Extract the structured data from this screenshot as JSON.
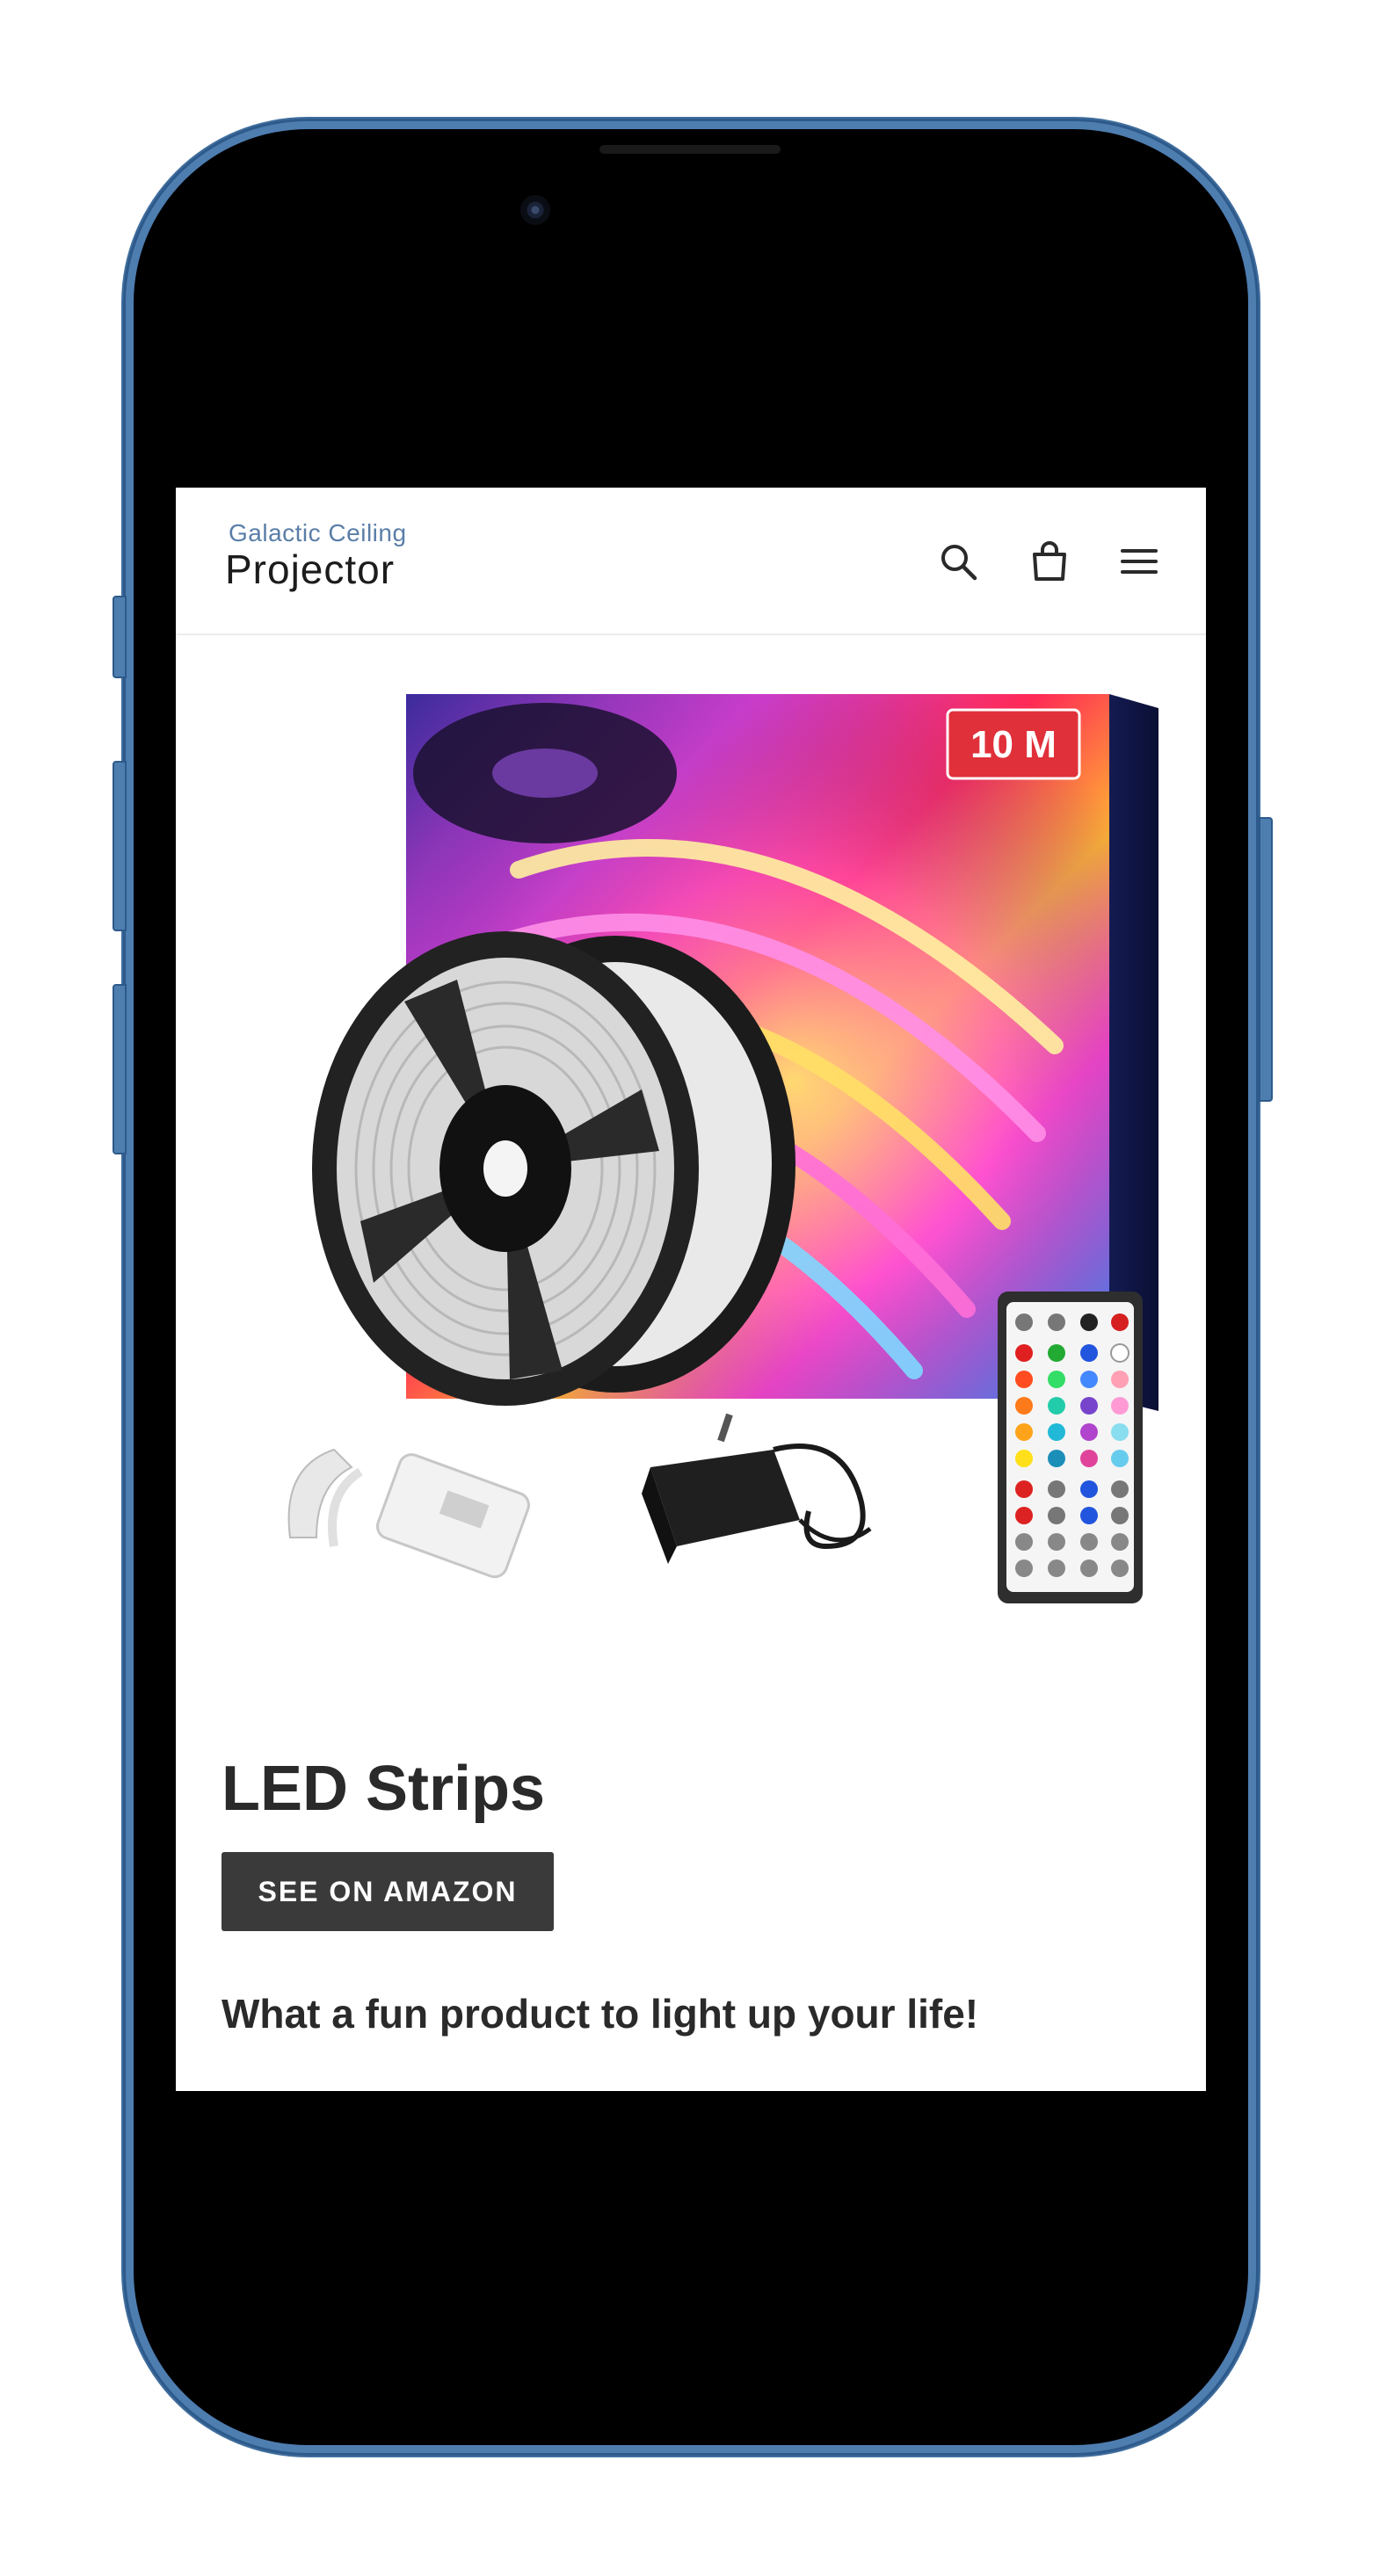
{
  "header": {
    "logo": {
      "top_text": "Galactic Ceiling",
      "bottom_text": "Projector"
    },
    "icons": [
      "search-icon",
      "cart-icon",
      "hamburger-menu-icon"
    ]
  },
  "product": {
    "image_alt": "LED strip light kit with two reels, remote control, controller and power adapter",
    "badge": "10 M",
    "title": "LED Strips",
    "button_label": "SEE ON AMAZON",
    "description": "What a fun product to light up your life!"
  },
  "colors": {
    "button_bg": "#3a3a3a",
    "text": "#2a2a2a",
    "logo_accent": "#5a7ea8",
    "phone_frame": "#4e7db0"
  }
}
